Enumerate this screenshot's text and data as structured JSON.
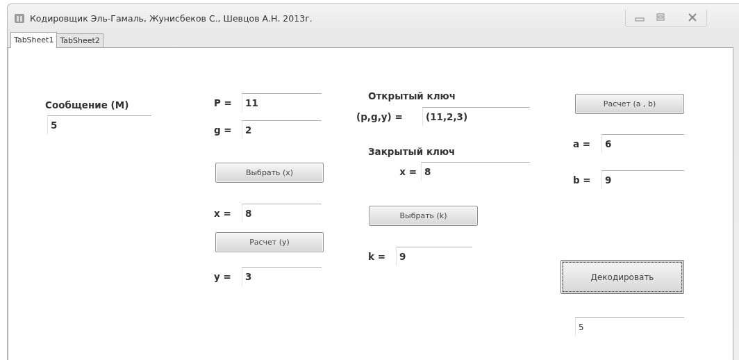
{
  "window": {
    "title": "Кодировщик  Эль-Гамаль,   Жунисбеков С., Шевцов А.Н.   2013г."
  },
  "tabs": [
    {
      "label": "TabSheet1",
      "selected": true
    },
    {
      "label": "TabSheet2",
      "selected": false
    }
  ],
  "columns": [
    {
      "items": [
        {
          "kind": "heading",
          "text": "Сообщение  (М)"
        },
        {
          "kind": "field",
          "value": "5"
        }
      ]
    },
    {
      "items": [
        {
          "kind": "field",
          "label": "P =",
          "value": "11"
        },
        {
          "kind": "field",
          "label": "g =",
          "value": "2"
        },
        {
          "kind": "button",
          "text": "Выбрать (x)"
        },
        {
          "kind": "field",
          "label": "x =",
          "value": "8"
        },
        {
          "kind": "button",
          "text": "Расчет  (y)"
        },
        {
          "kind": "field",
          "label": "y =",
          "value": "3"
        }
      ]
    },
    {
      "items": [
        {
          "kind": "heading",
          "text": "Открытый ключ"
        },
        {
          "kind": "field",
          "label": "(p,g,y) =",
          "value": "(11,2,3)"
        },
        {
          "kind": "heading",
          "text": "Закрытый ключ"
        },
        {
          "kind": "field",
          "label": "x =",
          "value": "8"
        },
        {
          "kind": "button",
          "text": "Выбрать (k)"
        },
        {
          "kind": "field",
          "label": "k =",
          "value": "9"
        }
      ]
    },
    {
      "items": [
        {
          "kind": "button",
          "text": "Расчет  (a , b)"
        },
        {
          "kind": "field",
          "label": "a =",
          "value": "6"
        },
        {
          "kind": "field",
          "label": "b =",
          "value": "9"
        },
        {
          "kind": "button",
          "text": "Декодировать",
          "focused": true
        },
        {
          "kind": "result",
          "value": "5"
        }
      ]
    }
  ]
}
